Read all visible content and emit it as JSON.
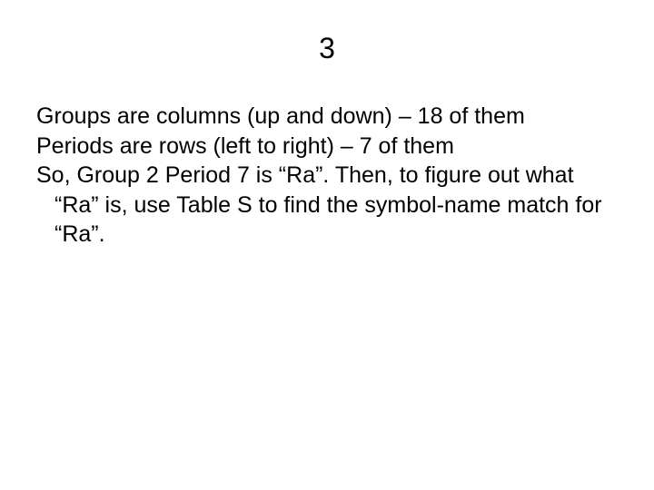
{
  "slide": {
    "title": "3",
    "paragraphs": [
      "Groups are columns (up and down) – 18 of them",
      "Periods are rows (left to right) – 7 of them",
      "So, Group 2 Period 7 is “Ra”.  Then, to figure out what “Ra” is, use Table S to find the symbol-name match for “Ra”."
    ]
  }
}
